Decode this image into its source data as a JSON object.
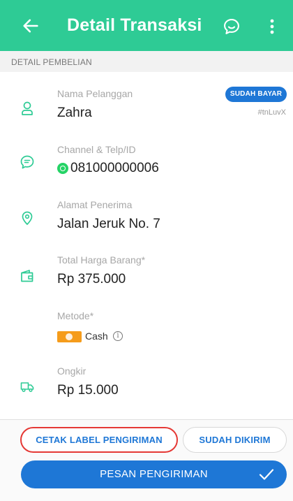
{
  "appbar": {
    "title": "Detail Transaksi",
    "back_icon": "arrow-left-icon",
    "chat_icon": "chat-bubble-icon",
    "more_icon": "more-vertical-icon",
    "color": "#2ecb95"
  },
  "section": {
    "title": "DETAIL PEMBELIAN"
  },
  "customer": {
    "label": "Nama Pelanggan",
    "value": "Zahra",
    "status_badge": "SUDAH BAYAR",
    "tag": "#tnLuvX"
  },
  "channel": {
    "label": "Channel & Telp/ID",
    "value": "081000000006",
    "channel_icon": "whatsapp-icon"
  },
  "address": {
    "label": "Alamat Penerima",
    "value": "Jalan Jeruk No. 7"
  },
  "total": {
    "label": "Total Harga Barang*",
    "value": "Rp 375.000"
  },
  "method": {
    "label": "Metode*",
    "value": "Cash",
    "info_glyph": "i"
  },
  "shipping": {
    "label": "Ongkir",
    "value": "Rp 15.000"
  },
  "actions": {
    "print_label": "CETAK LABEL PENGIRIMAN",
    "shipped": "SUDAH DIKIRIM",
    "order_shipping": "PESAN PENGIRIMAN"
  },
  "colors": {
    "accent": "#2ecb95",
    "primary": "#1e77d6",
    "highlight": "#e53935"
  }
}
